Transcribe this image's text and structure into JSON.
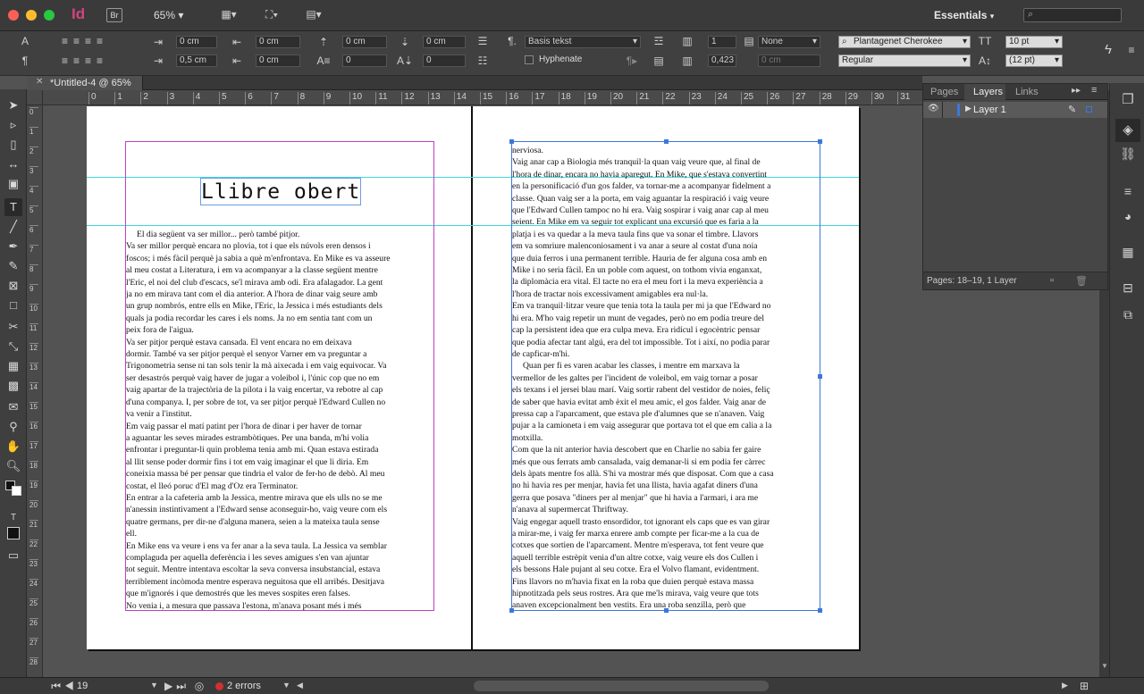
{
  "app": {
    "logo": "Id",
    "bridge": "Br",
    "zoom": "65%",
    "workspace": "Essentials"
  },
  "control": {
    "left_indent": "0 cm",
    "right_indent": "0 cm",
    "first_indent": "0,5 cm",
    "last_indent": "0 cm",
    "space_before": "0 cm",
    "space_after": "0 cm",
    "dropcap_lines": "0",
    "dropcap_chars": "0",
    "paragraph_style": "Basis tekst",
    "hyphenate_label": "Hyphenate",
    "columns": "1",
    "gutter": "0,423",
    "gutter2": "0 cm",
    "align_none": "None",
    "font_family": "Plantagenet Cherokee",
    "font_style": "Regular",
    "font_size": "10 pt",
    "leading": "(12 pt)"
  },
  "document": {
    "tab_title": "*Untitled-4 @ 65%"
  },
  "ruler": {
    "marks": [
      "0",
      "1",
      "2",
      "3",
      "4",
      "5",
      "6",
      "7",
      "8",
      "9",
      "10",
      "11",
      "12",
      "13",
      "14",
      "15",
      "16",
      "17",
      "18",
      "19",
      "20",
      "21",
      "22",
      "23",
      "24",
      "25",
      "26",
      "27",
      "28",
      "29",
      "30",
      "31"
    ]
  },
  "vruler": {
    "marks": [
      "0",
      "1",
      "2",
      "3",
      "4",
      "5",
      "6",
      "7",
      "8",
      "9",
      "10",
      "11",
      "12",
      "13",
      "14",
      "15",
      "16",
      "17",
      "18",
      "19",
      "20",
      "21",
      "22",
      "23",
      "24",
      "25",
      "26",
      "27",
      "28"
    ]
  },
  "left_page": {
    "title": "Llibre obert",
    "text": "     El dia següent va ser millor... però també pitjor.\nVa ser millor perquè encara no plovia, tot i que els núvols eren densos i\nfoscos; i més fàcil perquè ja sabia a què m'enfrontava. En Mike es va asseure\nal meu costat a Literatura, i em va acompanyar a la classe següent mentre\nl'Eric, el noi del club d'escacs, se'l mirava amb odi. Era afalagador. La gent\nja no em mirava tant com el dia anterior. A l'hora de dinar vaig seure amb\nun grup nombrós, entre ells en Mike, l'Eric, la Jessica i més estudiants dels\nquals ja podia recordar les cares i els noms. Ja no em sentia tant com un\npeix fora de l'aigua.\nVa ser pitjor perquè estava cansada. El vent encara no em deixava\ndormir. També va ser pitjor perquè el senyor Varner em va preguntar a\nTrigonometria sense ni tan sols tenir la mà aixecada i em vaig equivocar. Va\nser desastrós perquè vaig haver de jugar a voleibol i, l'únic cop que no em\nvaig apartar de la trajectòria de la pilota i la vaig encertar, va rebotre al cap\nd'una companya. I, per sobre de tot, va ser pitjor perquè l'Edward Cullen no\nva venir a l'institut.\nEm vaig passar el matí patint per l'hora de dinar i per haver de tornar\na aguantar les seves mirades estrambòtiques. Per una banda, m'hi volia\nenfrontar i preguntar-li quin problema tenia amb mi. Quan estava estirada\nal llit sense poder dormir fins i tot em vaig imaginar el que li diria. Em\nconeixia massa bé per pensar que tindria el valor de fer-ho de debò. Al meu\ncostat, el lleó poruc d'El mag d'Oz era Terminator.\nEn entrar a la cafeteria amb la Jessica, mentre mirava que els ulls no se me\nn'anessin instintivament a l'Edward sense aconseguir-ho, vaig veure com els\nquatre germans, per dir-ne d'alguna manera, seien a la mateixa taula sense\nell.\nEn Mike ens va veure i ens va fer anar a la seva taula. La Jessica va semblar\ncomplaguda per aquella deferència i les seves amigues s'en van ajuntar\ntot seguit. Mentre intentava escoltar la seva conversa insubstancial, estava\nterriblement incòmoda mentre esperava neguitosa que ell arribés. Desitjava\nque m'ignorés i que demostrés que les meves sospites eren falses.\nNo venia i, a mesura que passava l'estona, m'anava posant més i més"
  },
  "right_page": {
    "text": "nerviosa.\nVaig anar cap a Biologia més tranquil·la quan vaig veure que, al final de\nl'hora de dinar, encara no havia aparegut. En Mike, que s'estava convertint\nen la personificació d'un gos falder, va tornar-me a acompanyar fidelment a\nclasse. Quan vaig ser a la porta, em vaig aguantar la respiració i vaig veure\nque l'Edward Cullen tampoc no hi era. Vaig sospirar i vaig anar cap al meu\nseient. En Mike em va seguir tot explicant una excursió que es faria a la\nplatja i es va quedar a la meva taula fins que va sonar el timbre. Llavors\nem va somriure malenconiosament i va anar a seure al costat d'una noia\nque duia ferros i una permanent terrible. Hauria de fer alguna cosa amb en\nMike i no seria fàcil. En un poble com aquest, on tothom vivia enganxat,\nla diplomàcia era vital. El tacte no era el meu fort i la meva experiència a\nl'hora de tractar nois excessivament amigables era nul·la.\nEm va tranquil·litzar veure que tenia tota la taula per mi ja que l'Edward no\nhi era. M'ho vaig repetir un munt de vegades, però no em podia treure del\ncap la persistent idea que era culpa meva. Era ridícul i egocèntric pensar\nque podia afectar tant algú, era del tot impossible. Tot i així, no podia parar\nde capficar-m'hi.\n     Quan per fi es varen acabar les classes, i mentre em marxava la\nvermellor de les galtes per l'incident de voleibol, em vaig tornar a posar\nels texans i el jersei blau marí. Vaig sortir rabent del vestidor de noies, feliç\nde saber que havia evitat amb èxit el meu amic, el gos falder. Vaig anar de\npressa cap a l'aparcament, que estava ple d'alumnes que se n'anaven. Vaig\npujar a la camioneta i em vaig assegurar que portava tot el que em calia a la\nmotxilla.\nCom que la nit anterior havia descobert que en Charlie no sabia fer gaire\nmés que ous ferrats amb cansalada, vaig demanar-li si em podia fer càrrec\ndels àpats mentre fos allà. S'hi va mostrar més que disposat. Com que a casa\nno hi havia res per menjar, havia fet una llista, havia agafat diners d'una\ngerra que posava \"diners per al menjar\" que hi havia a l'armari, i ara me\nn'anava al supermercat Thriftway.\nVaig engegar aquell trasto ensordidor, tot ignorant els caps que es van girar\na mirar-me, i vaig fer marxa enrere amb compte per ficar-me a la cua de\ncotxes que sortien de l'aparcament. Mentre m'esperava, tot fent veure que\naquell terrible estrèpit venia d'un altre cotxe, vaig veure els dos Cullen i\nels bessons Hale pujant al seu cotxe. Era el Volvo flamant, evidentment.\nFins llavors no m'havia fixat en la roba que duien perquè estava massa\nhipnotitzada pels seus rostres. Ara que me'ls mirava, vaig veure que tots\nanaven excepcionalment ben vestits. Era una roba senzilla, però que"
  },
  "layers_panel": {
    "tabs": [
      "Pages",
      "Layers",
      "Links"
    ],
    "layers": [
      {
        "name": "Layer 1"
      }
    ],
    "footer": "Pages: 18–19, 1 Layer"
  },
  "status": {
    "page": "19",
    "errors": "2 errors"
  },
  "colors": {
    "accent_blue": "#3d78d8",
    "frame_magenta": "#c040c0",
    "guide_cyan": "#3fd8d8",
    "error_red": "#d03030"
  }
}
